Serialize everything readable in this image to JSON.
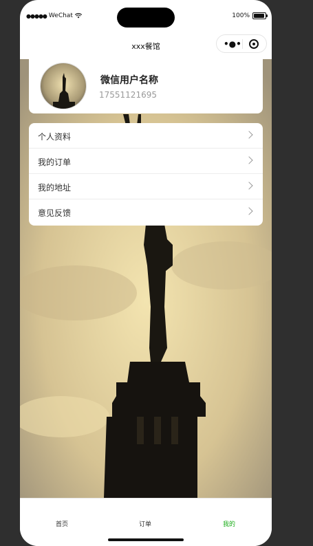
{
  "status_bar": {
    "carrier": "WeChat",
    "battery": "100%"
  },
  "nav": {
    "title": "xxx餐馆",
    "more_icon": "more-dots-icon",
    "close_icon": "target-icon"
  },
  "profile": {
    "name": "微信用户名称",
    "phone": "17551121695"
  },
  "menu": [
    {
      "label": "个人资料"
    },
    {
      "label": "我的订单"
    },
    {
      "label": "我的地址"
    },
    {
      "label": "意见反馈"
    }
  ],
  "tabs": [
    {
      "label": "首页",
      "active": false
    },
    {
      "label": "订单",
      "active": false
    },
    {
      "label": "我的",
      "active": true
    }
  ],
  "colors": {
    "active_tab": "#1aad19",
    "background": "#2f2f2f"
  }
}
